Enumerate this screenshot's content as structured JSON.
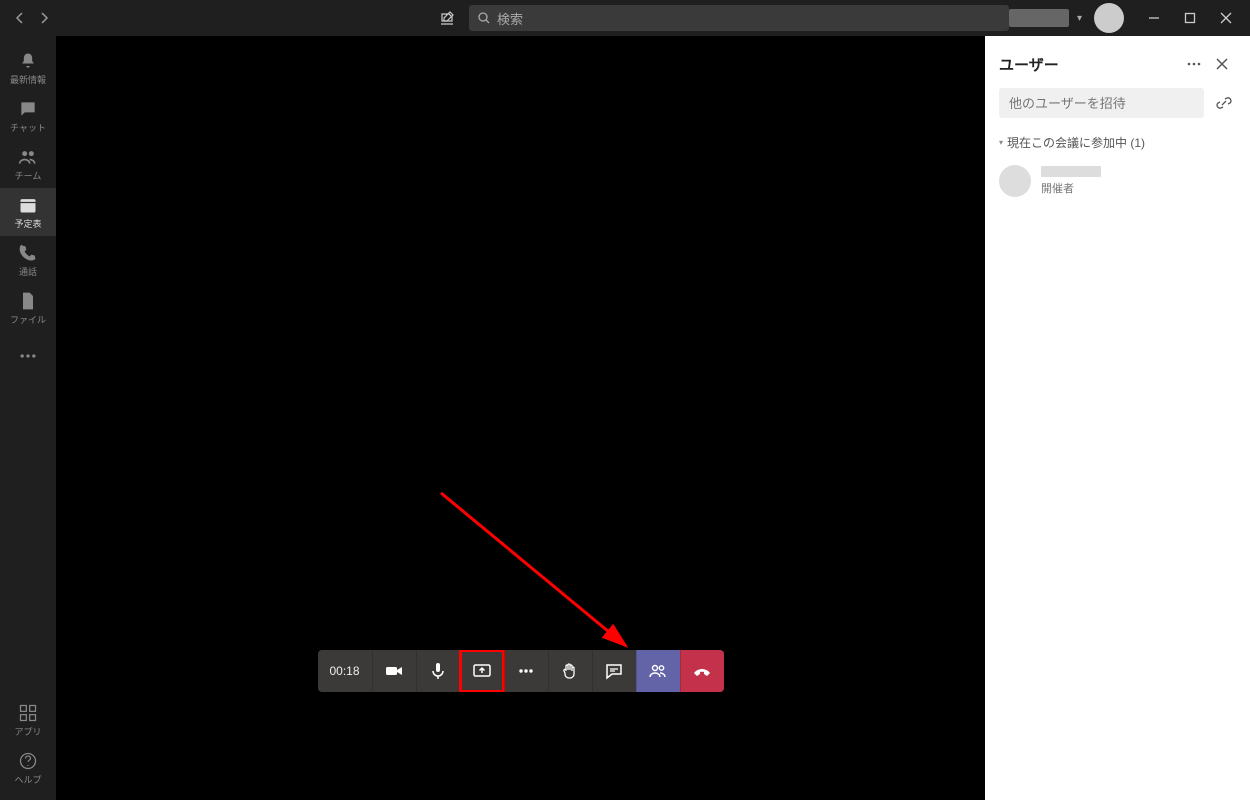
{
  "titlebar": {
    "search_placeholder": "検索"
  },
  "rail": {
    "items": [
      {
        "label": "最新情報"
      },
      {
        "label": "チャット"
      },
      {
        "label": "チーム"
      },
      {
        "label": "予定表"
      },
      {
        "label": "通話"
      },
      {
        "label": "ファイル"
      }
    ],
    "apps_label": "アプリ",
    "help_label": "ヘルプ"
  },
  "meeting": {
    "timer": "00:18"
  },
  "panel": {
    "title": "ユーザー",
    "invite_placeholder": "他のユーザーを招待",
    "section_label": "現在この会議に参加中 (1)",
    "participant_role": "開催者"
  }
}
